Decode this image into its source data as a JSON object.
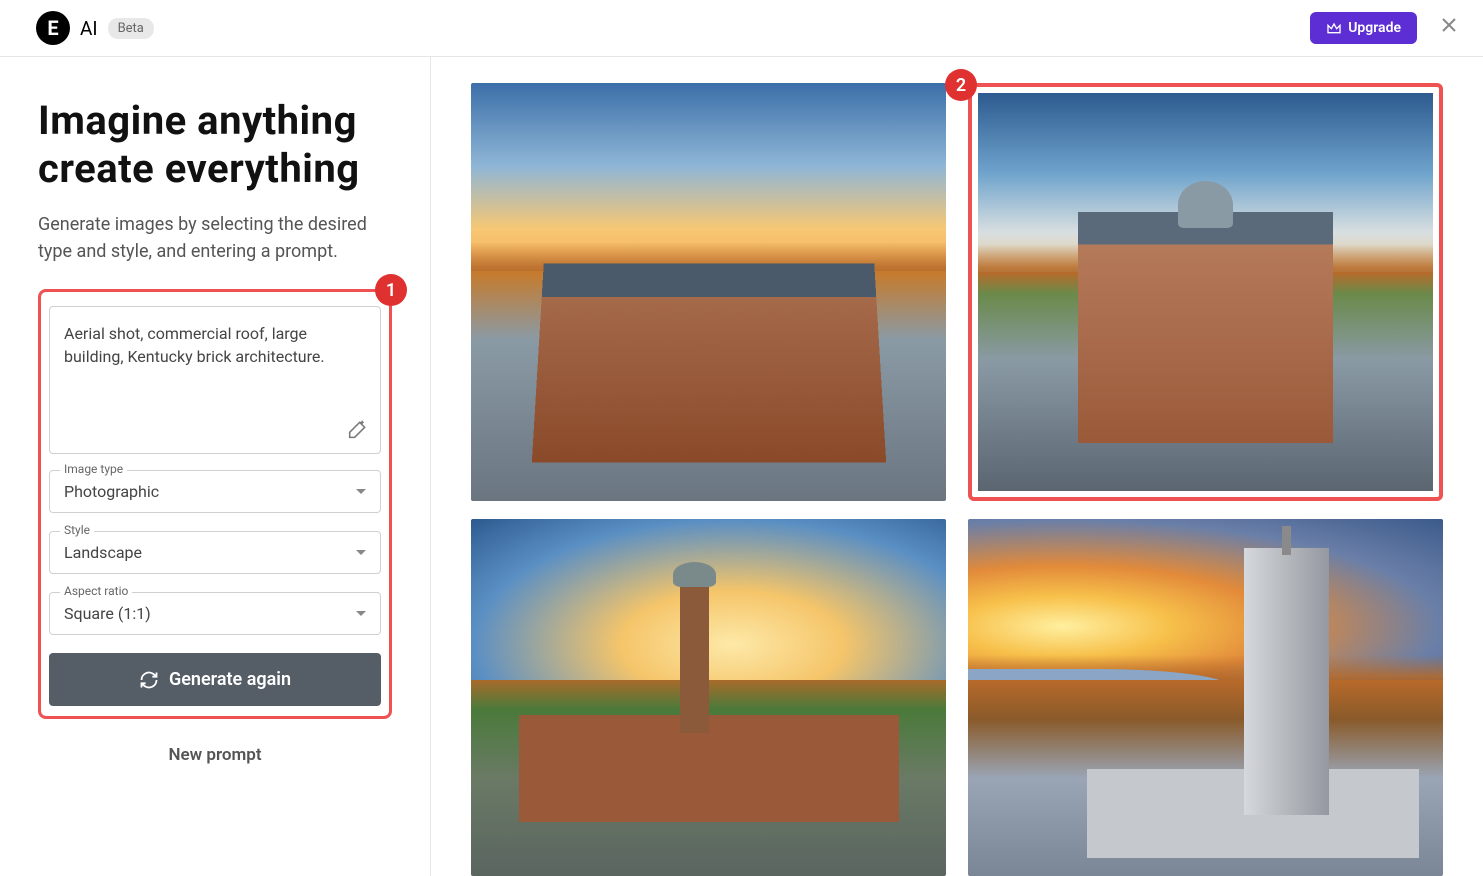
{
  "header": {
    "logo_letter": "E",
    "logo_text": "AI",
    "beta_label": "Beta",
    "upgrade_label": "Upgrade"
  },
  "sidebar": {
    "title_line1": "Imagine anything",
    "title_line2": "create everything",
    "subtitle": "Generate images by selecting the desired type and style, and entering a prompt.",
    "prompt_value": "Aerial shot, commercial roof, large building, Kentucky brick architecture.",
    "image_type": {
      "label": "Image type",
      "value": "Photographic"
    },
    "style": {
      "label": "Style",
      "value": "Landscape"
    },
    "aspect_ratio": {
      "label": "Aspect ratio",
      "value": "Square (1:1)"
    },
    "generate_label": "Generate again",
    "new_prompt_label": "New prompt"
  },
  "callouts": {
    "one": "1",
    "two": "2"
  }
}
